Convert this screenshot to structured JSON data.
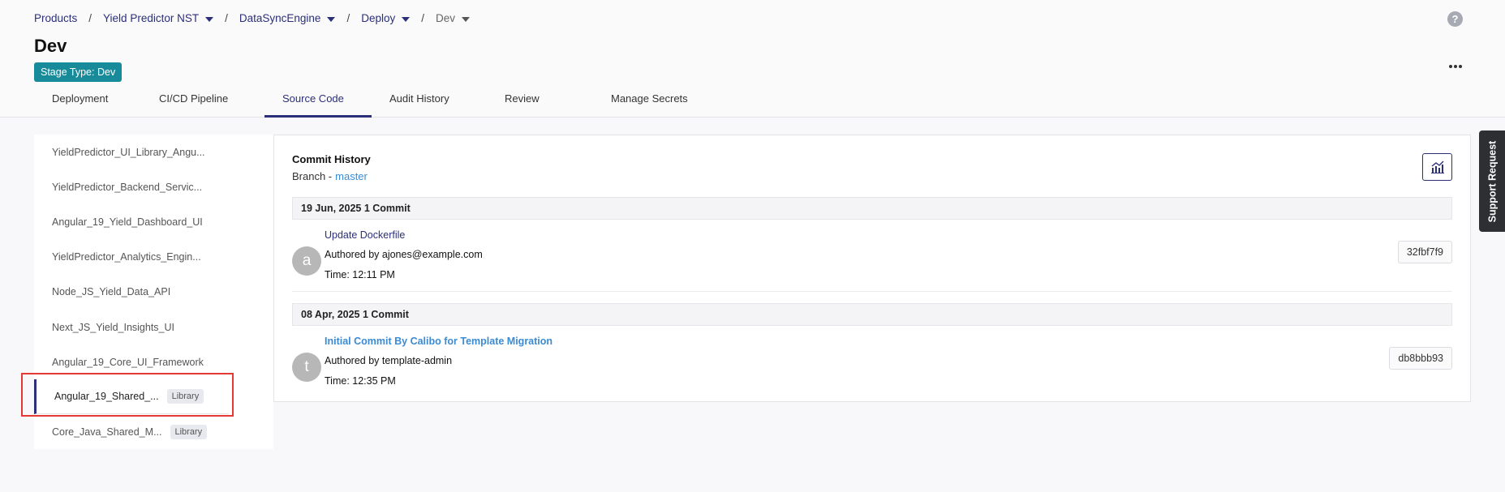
{
  "breadcrumb": [
    {
      "label": "Products",
      "caret": false
    },
    {
      "label": "Yield Predictor NST",
      "caret": true
    },
    {
      "label": "DataSyncEngine",
      "caret": true
    },
    {
      "label": "Deploy",
      "caret": true
    },
    {
      "label": "Dev",
      "caret": true
    }
  ],
  "page": {
    "title": "Dev",
    "stage_badge": "Stage Type: Dev",
    "help_icon": "?"
  },
  "tabs": [
    {
      "label": "Deployment"
    },
    {
      "label": "CI/CD Pipeline"
    },
    {
      "label": "Source Code",
      "active": true
    },
    {
      "label": "Audit History"
    },
    {
      "label": "Review"
    },
    {
      "label": "Manage Secrets"
    }
  ],
  "repos": [
    {
      "name": "YieldPredictor_UI_Library_Angu..."
    },
    {
      "name": "YieldPredictor_Backend_Servic..."
    },
    {
      "name": "Angular_19_Yield_Dashboard_UI"
    },
    {
      "name": "YieldPredictor_Analytics_Engin..."
    },
    {
      "name": "Node_JS_Yield_Data_API"
    },
    {
      "name": "Next_JS_Yield_Insights_UI"
    },
    {
      "name": "Angular_19_Core_UI_Framework"
    },
    {
      "name": "Angular_19_Shared_...",
      "badge": "Library",
      "active": true
    },
    {
      "name": "Core_Java_Shared_M...",
      "badge": "Library"
    }
  ],
  "commit_history": {
    "title": "Commit History",
    "branch_label": "Branch -",
    "branch_name": "master",
    "groups": [
      {
        "date": "19 Jun, 2025 1 Commit",
        "commits": [
          {
            "avatar": "a",
            "message": "Update Dockerfile",
            "author": "Authored by ajones@example.com",
            "time": "Time: 12:11 PM",
            "sha": "32fbf7f9"
          }
        ]
      },
      {
        "date": "08 Apr, 2025 1 Commit",
        "commits": [
          {
            "avatar": "t",
            "message": "Initial Commit By Calibo for Template Migration",
            "author": "Authored by template-admin",
            "time": "Time: 12:35 PM",
            "sha": "db8bbb93"
          }
        ]
      }
    ]
  },
  "support_request": "Support Request"
}
